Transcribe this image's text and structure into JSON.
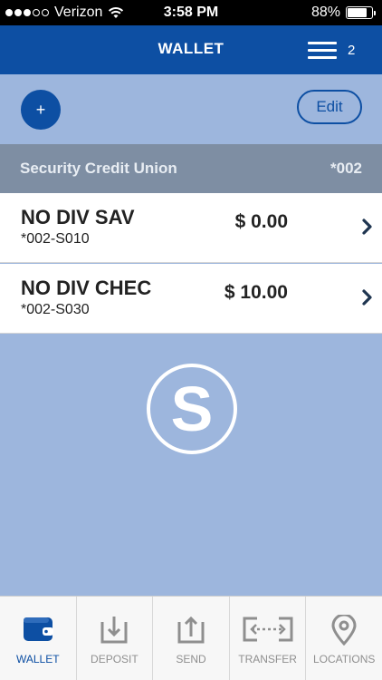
{
  "status_bar": {
    "carrier": "Verizon",
    "time": "3:58 PM",
    "battery": "88%",
    "battery_level": 0.88,
    "signal_bars": 3,
    "signal_total": 5
  },
  "nav": {
    "title": "WALLET",
    "menu_count": "2",
    "menu_icon": "hamburger-menu-icon"
  },
  "actions": {
    "add_label": "+",
    "edit_label": "Edit"
  },
  "group": {
    "name": "Security Credit Union",
    "suffix": "*002"
  },
  "accounts": [
    {
      "name": "NO DIV SAV",
      "number": "*002-S010",
      "balance": "$ 0.00"
    },
    {
      "name": "NO DIV CHEC",
      "number": "*002-S030",
      "balance": "$ 10.00"
    }
  ],
  "logo": {
    "letter": "S"
  },
  "tabs": [
    {
      "label": "WALLET",
      "icon": "wallet-icon",
      "active": true
    },
    {
      "label": "DEPOSIT",
      "icon": "deposit-icon",
      "active": false
    },
    {
      "label": "SEND",
      "icon": "send-icon",
      "active": false
    },
    {
      "label": "TRANSFER",
      "icon": "transfer-icon",
      "active": false
    },
    {
      "label": "LOCATIONS",
      "icon": "location-pin-icon",
      "active": false
    }
  ],
  "colors": {
    "brand_blue": "#0d4fa3",
    "background": "#9db6dd",
    "group_header": "#7e8ea3",
    "tab_inactive": "#8f8f8f"
  }
}
